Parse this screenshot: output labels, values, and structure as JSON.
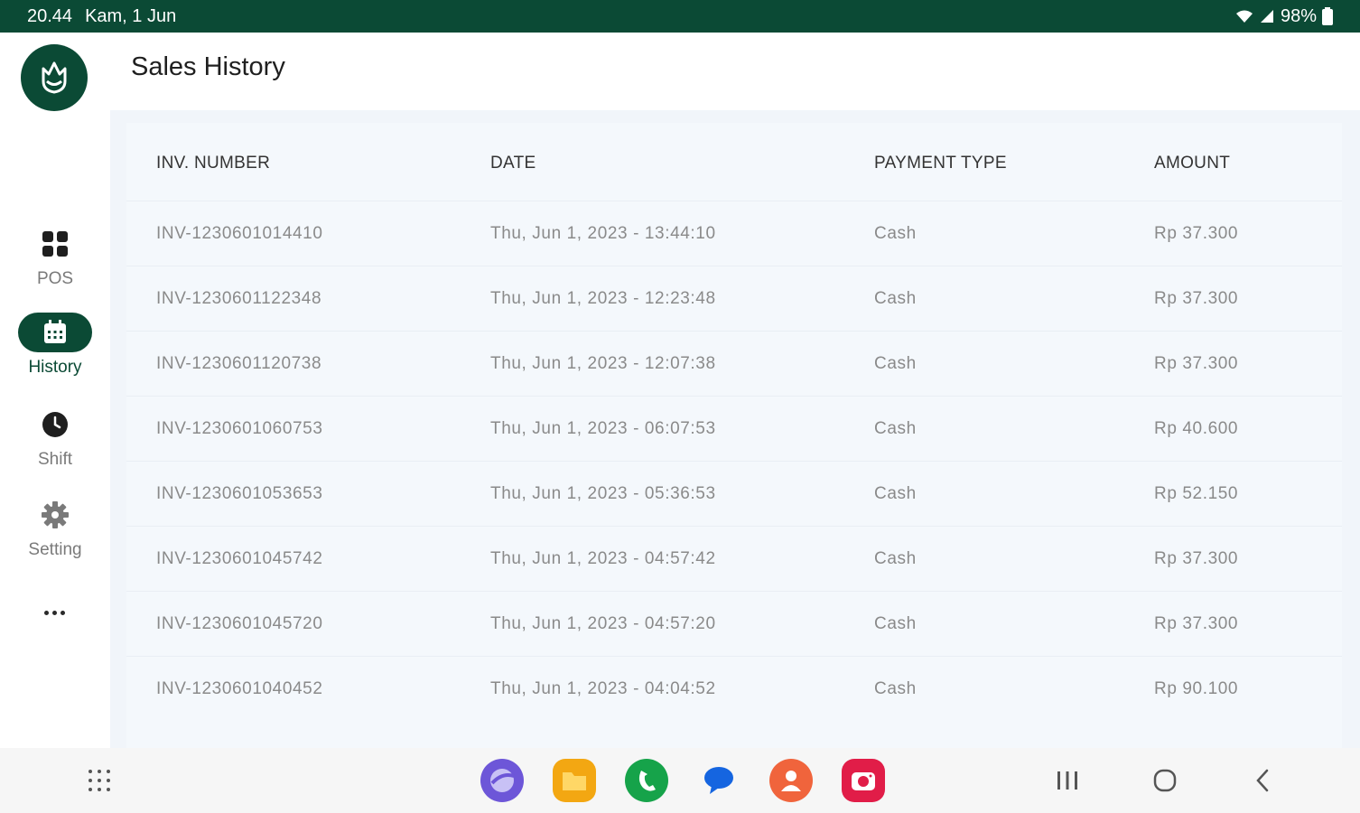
{
  "status_bar": {
    "time": "20.44",
    "date": "Kam, 1 Jun",
    "battery": "98%",
    "icons": [
      "wifi-icon",
      "signal-icon",
      "battery-icon"
    ]
  },
  "app": {
    "title": "Sales History",
    "accent_color": "#0b4a35",
    "logo_icon": "lotus-logo-icon"
  },
  "nav": {
    "items": [
      {
        "label": "POS",
        "icon": "grid-icon"
      },
      {
        "label": "History",
        "icon": "calendar-icon",
        "active": true
      },
      {
        "label": "Shift",
        "icon": "clock-icon"
      },
      {
        "label": "Setting",
        "icon": "gear-icon"
      }
    ],
    "more_icon": "more-dots-icon"
  },
  "table": {
    "headers": [
      "INV. NUMBER",
      "DATE",
      "PAYMENT TYPE",
      "AMOUNT"
    ],
    "rows": [
      [
        "INV-1230601014410",
        "Thu, Jun 1, 2023 - 13:44:10",
        "Cash",
        "Rp 37.300"
      ],
      [
        "INV-1230601122348",
        "Thu, Jun 1, 2023 - 12:23:48",
        "Cash",
        "Rp 37.300"
      ],
      [
        "INV-1230601120738",
        "Thu, Jun 1, 2023 - 12:07:38",
        "Cash",
        "Rp 37.300"
      ],
      [
        "INV-1230601060753",
        "Thu, Jun 1, 2023 - 06:07:53",
        "Cash",
        "Rp 40.600"
      ],
      [
        "INV-1230601053653",
        "Thu, Jun 1, 2023 - 05:36:53",
        "Cash",
        "Rp 52.150"
      ],
      [
        "INV-1230601045742",
        "Thu, Jun 1, 2023 - 04:57:42",
        "Cash",
        "Rp 37.300"
      ],
      [
        "INV-1230601045720",
        "Thu, Jun 1, 2023 - 04:57:20",
        "Cash",
        "Rp 37.300"
      ],
      [
        "INV-1230601040452",
        "Thu, Jun 1, 2023 - 04:04:52",
        "Cash",
        "Rp 90.100"
      ]
    ]
  },
  "system_nav": {
    "apps": [
      "internet-app-icon",
      "files-app-icon",
      "phone-app-icon",
      "messages-app-icon",
      "contacts-app-icon",
      "camera-app-icon"
    ],
    "buttons": [
      "recents-icon",
      "home-icon",
      "back-icon"
    ],
    "app_drawer_icon": "app-drawer-icon"
  }
}
